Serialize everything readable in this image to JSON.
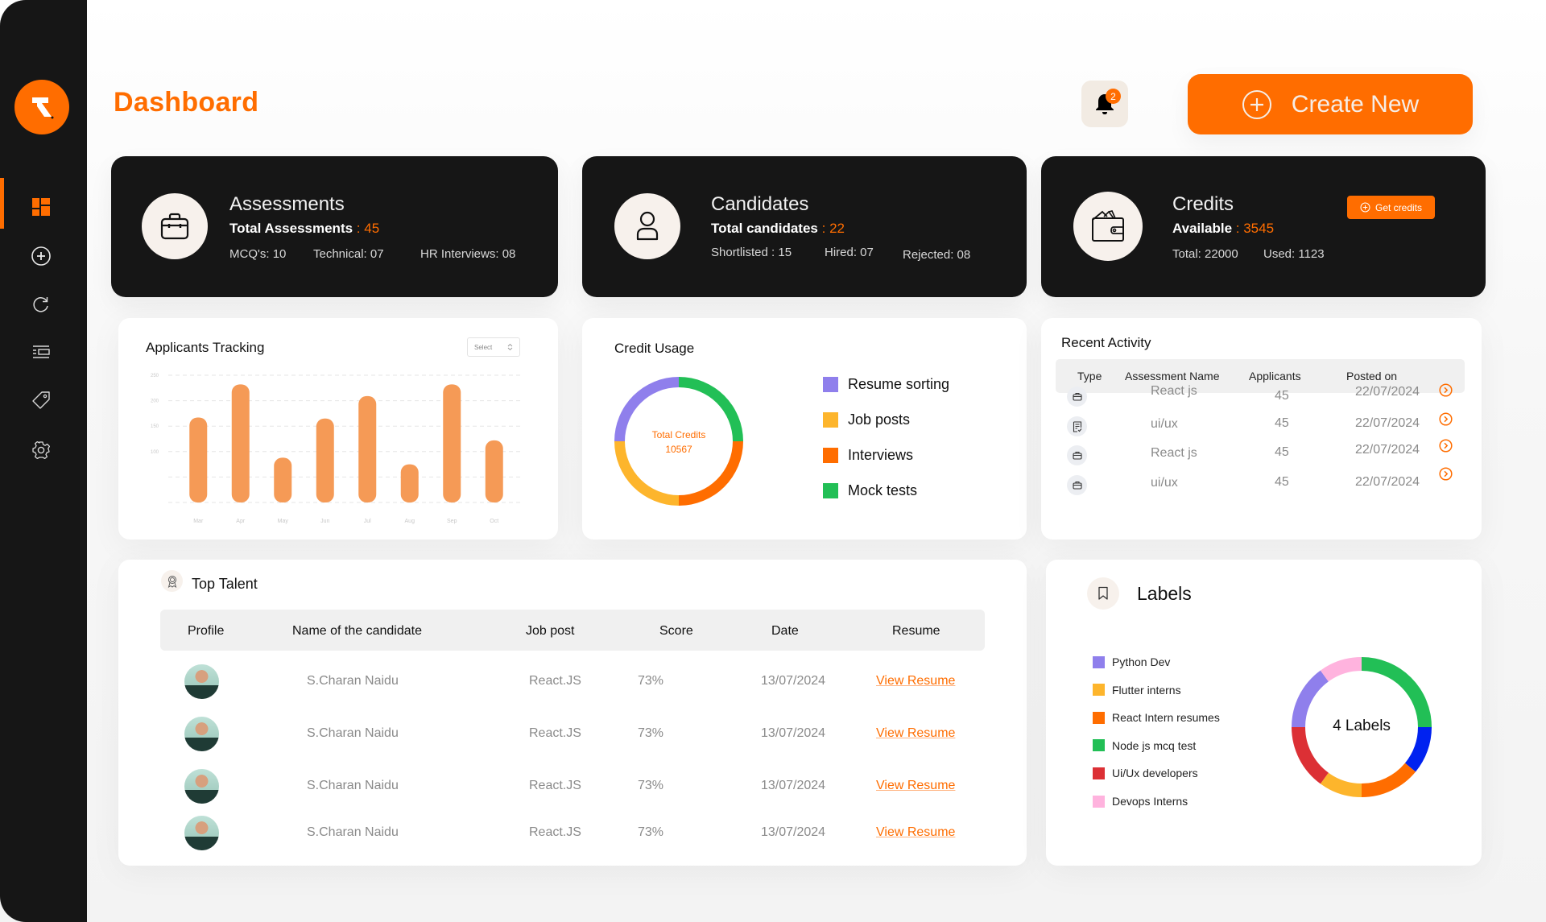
{
  "sidebar": {
    "logo_letter": "R",
    "items": [
      {
        "name": "dashboard",
        "icon": "dashboard-grid-icon",
        "active": true
      },
      {
        "name": "create",
        "icon": "plus-circle-icon",
        "active": false
      },
      {
        "name": "refresh",
        "icon": "refresh-icon",
        "active": false
      },
      {
        "name": "list",
        "icon": "list-icon",
        "active": false
      },
      {
        "name": "tags",
        "icon": "tag-icon",
        "active": false
      },
      {
        "name": "settings",
        "icon": "gear-icon",
        "active": false
      }
    ]
  },
  "header": {
    "title": "Dashboard",
    "notifications_count": "2",
    "create_label": "Create New"
  },
  "colors": {
    "accent": "#ff6d00",
    "dark": "#161616",
    "purple": "#8f7fec",
    "yellow": "#fdb52c",
    "orange": "#ff6d00",
    "green": "#22bf56",
    "blue": "#0022f0",
    "red": "#dc3035",
    "pink": "#ffb3de"
  },
  "stats": {
    "assessments": {
      "title": "Assessments",
      "total_label": "Total Assessments",
      "total_value": "45",
      "subs": [
        "MCQ's: 10",
        "Technical: 07",
        "HR Interviews: 08"
      ]
    },
    "candidates": {
      "title": "Candidates",
      "total_label": "Total candidates",
      "total_value": "22",
      "subs": [
        "Shortlisted : 15",
        "Hired: 07",
        "Rejected: 08"
      ]
    },
    "credits": {
      "title": "Credits",
      "total_label": "Available",
      "total_value": "3545",
      "subs": [
        "Total: 22000",
        "Used: 1123"
      ],
      "get_credits_label": "Get credits"
    }
  },
  "applicants": {
    "title": "Applicants Tracking",
    "select_placeholder": "Select"
  },
  "credit_usage": {
    "title": "Credit Usage",
    "center_label": "Total Credits",
    "center_value": "10567"
  },
  "recent_activity": {
    "title": "Recent Activity",
    "columns": [
      "Type",
      "Assessment Name",
      "Applicants",
      "Posted on"
    ],
    "rows": [
      {
        "type_icon": "briefcase-icon",
        "name": "React js",
        "applicants": "45",
        "posted": "22/07/2024"
      },
      {
        "type_icon": "document-check-icon",
        "name": "ui/ux",
        "applicants": "45",
        "posted": "22/07/2024"
      },
      {
        "type_icon": "briefcase-icon",
        "name": "React js",
        "applicants": "45",
        "posted": "22/07/2024"
      },
      {
        "type_icon": "briefcase-icon",
        "name": "ui/ux",
        "applicants": "45",
        "posted": "22/07/2024"
      }
    ]
  },
  "top_talent": {
    "title": "Top Talent",
    "columns": [
      "Profile",
      "Name of the candidate",
      "Job post",
      "Score",
      "Date",
      "Resume"
    ],
    "rows": [
      {
        "name": "S.Charan Naidu",
        "job": "React.JS",
        "score": "73%",
        "date": "13/07/2024",
        "resume": "View Resume"
      },
      {
        "name": "S.Charan Naidu",
        "job": "React.JS",
        "score": "73%",
        "date": "13/07/2024",
        "resume": "View Resume"
      },
      {
        "name": "S.Charan Naidu",
        "job": "React.JS",
        "score": "73%",
        "date": "13/07/2024",
        "resume": "View Resume"
      },
      {
        "name": "S.Charan Naidu",
        "job": "React.JS",
        "score": "73%",
        "date": "13/07/2024",
        "resume": "View Resume"
      }
    ]
  },
  "labels_panel": {
    "title": "Labels",
    "center_text": "4 Labels"
  },
  "chart_data": [
    {
      "type": "bar",
      "title": "Applicants Tracking",
      "categories": [
        "Mar",
        "Apr",
        "May",
        "Jun",
        "Jul",
        "Aug",
        "Sep",
        "Oct"
      ],
      "values": [
        167,
        232,
        88,
        165,
        209,
        75,
        232,
        122
      ],
      "yticks": [
        100,
        150,
        200,
        250
      ],
      "gridlines": [
        0,
        50,
        100,
        150,
        200,
        250
      ],
      "ylim": [
        0,
        250
      ],
      "xlabel": "",
      "ylabel": "",
      "grid": true,
      "color": "#f59a56"
    },
    {
      "type": "pie",
      "title": "Credit Usage",
      "donut": true,
      "center_label": "Total Credits 10567",
      "slices": [
        {
          "label": "Mock tests",
          "value": 25,
          "color": "#22bf56"
        },
        {
          "label": "Interviews",
          "value": 25,
          "color": "#ff6d00"
        },
        {
          "label": "Job posts",
          "value": 25,
          "color": "#fdb52c"
        },
        {
          "label": "Resume sorting",
          "value": 25,
          "color": "#8f7fec"
        }
      ],
      "legend": [
        {
          "label": "Resume sorting",
          "color": "#8f7fec"
        },
        {
          "label": "Job posts",
          "color": "#fdb52c"
        },
        {
          "label": "Interviews",
          "color": "#ff6d00"
        },
        {
          "label": "Mock tests",
          "color": "#22bf56"
        }
      ],
      "legend_position": "right"
    },
    {
      "type": "pie",
      "title": "Labels",
      "donut": true,
      "center_label": "4 Labels",
      "slices": [
        {
          "label": "Node js mcq test",
          "value": 25,
          "color": "#22bf56"
        },
        {
          "label": "blue segment",
          "value": 11,
          "color": "#0022f0"
        },
        {
          "label": "React Intern resumes",
          "value": 14,
          "color": "#ff6d00"
        },
        {
          "label": "Flutter interns",
          "value": 10,
          "color": "#fdb52c"
        },
        {
          "label": "Ui/Ux developers",
          "value": 15,
          "color": "#dc3035"
        },
        {
          "label": "Python Dev",
          "value": 15,
          "color": "#8f7fec"
        },
        {
          "label": "Devops Interns",
          "value": 10,
          "color": "#ffb3de"
        }
      ],
      "legend": [
        {
          "label": "Python Dev",
          "color": "#8f7fec"
        },
        {
          "label": "Flutter interns",
          "color": "#fdb52c"
        },
        {
          "label": "React Intern resumes",
          "color": "#ff6d00"
        },
        {
          "label": "Node js mcq test",
          "color": "#22bf56"
        },
        {
          "label": "Ui/Ux developers",
          "color": "#dc3035"
        },
        {
          "label": "Devops Interns",
          "color": "#ffb3de"
        }
      ],
      "legend_position": "left"
    }
  ]
}
